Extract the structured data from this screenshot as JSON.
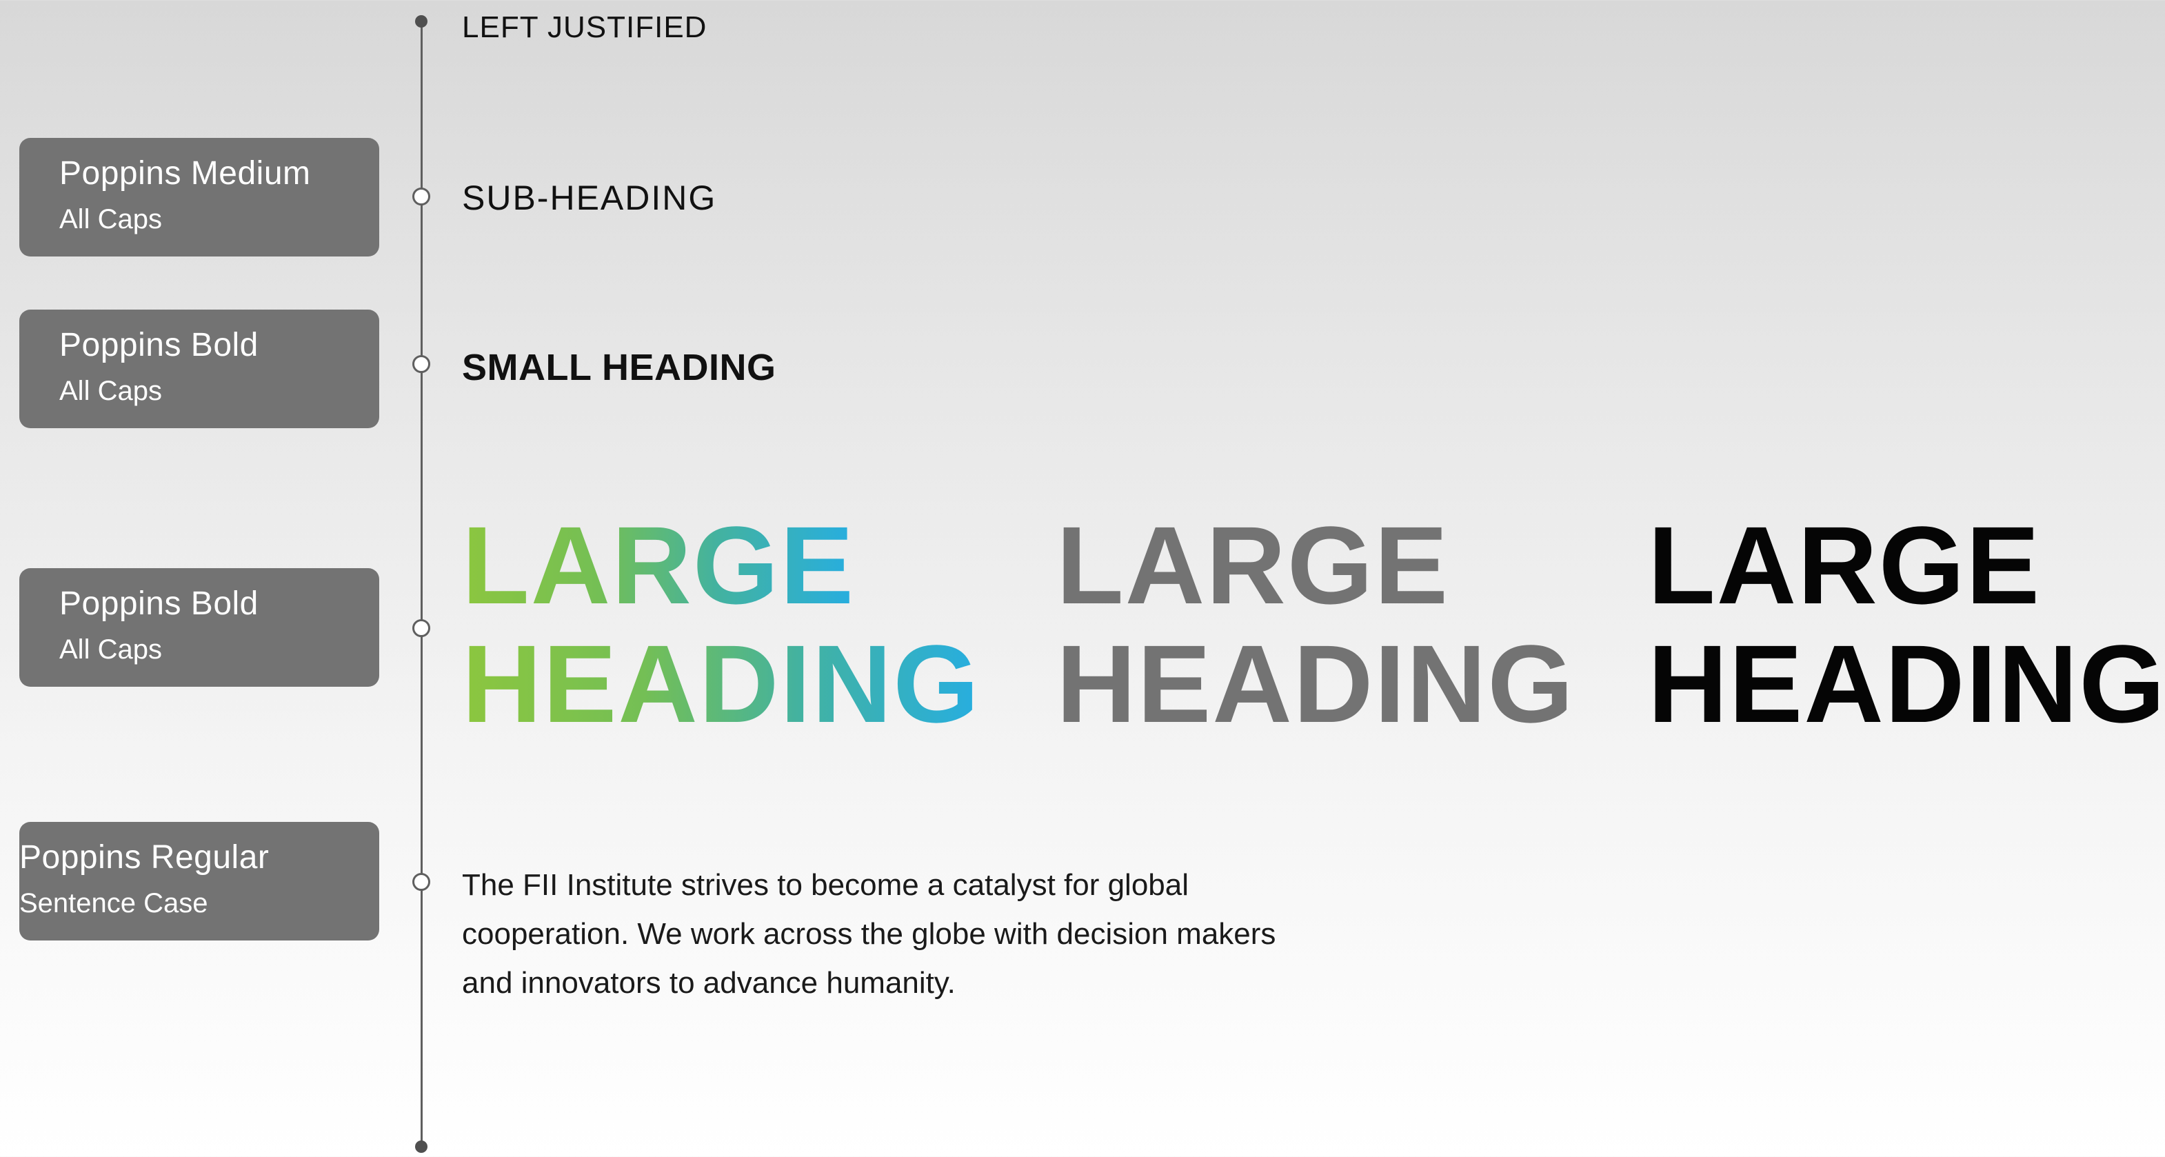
{
  "colors": {
    "label_bg": "#737373",
    "timeline": "#5f5f5f",
    "gradient_start": "#8cc63f",
    "gradient_end": "#27aee0",
    "gray_heading": "#737373",
    "black_heading": "#050505"
  },
  "labels": [
    {
      "title": "Poppins Medium",
      "subtitle": "All Caps"
    },
    {
      "title": "Poppins Bold",
      "subtitle": "All Caps"
    },
    {
      "title": "Poppins Bold",
      "subtitle": "All Caps"
    },
    {
      "title": "Poppins Regular",
      "subtitle": "Sentence Case"
    }
  ],
  "samples": {
    "left_justified": "LEFT JUSTIFIED",
    "sub_heading": "SUB-HEADING",
    "small_heading": "SMALL HEADING",
    "large_heading": {
      "line1": "LARGE",
      "line2": "HEADING"
    },
    "body": "The FII Institute strives to become a catalyst for global cooperation. We work across the globe with decision makers and innovators to advance humanity."
  }
}
